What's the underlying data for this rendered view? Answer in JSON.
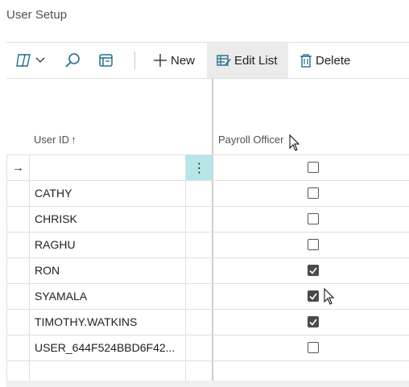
{
  "page": {
    "title": "User Setup"
  },
  "toolbar": {
    "analysis_icon": "analysis-mode-icon",
    "search_icon": "search-icon",
    "filter_icon": "filter-pane-icon",
    "new_label": "New",
    "edit_list_label": "Edit List",
    "delete_label": "Delete"
  },
  "columns": {
    "user_id": "User ID",
    "user_id_sort": "↑",
    "payroll_officer": "Payroll Officer"
  },
  "rows": [
    {
      "user_id": "",
      "payroll_officer": false,
      "selected": true,
      "row_indicator": "→"
    },
    {
      "user_id": "CATHY",
      "payroll_officer": false
    },
    {
      "user_id": "CHRISK",
      "payroll_officer": false
    },
    {
      "user_id": "RAGHU",
      "payroll_officer": false
    },
    {
      "user_id": "RON",
      "payroll_officer": true
    },
    {
      "user_id": "SYAMALA",
      "payroll_officer": true
    },
    {
      "user_id": "TIMOTHY.WATKINS",
      "payroll_officer": true
    },
    {
      "user_id": "USER_644F524BBD6F42...",
      "payroll_officer": false
    },
    {
      "user_id": "",
      "payroll_officer": null
    }
  ],
  "colors": {
    "accent": "#b6e6e8",
    "text": "#212121",
    "muted": "#505050"
  }
}
